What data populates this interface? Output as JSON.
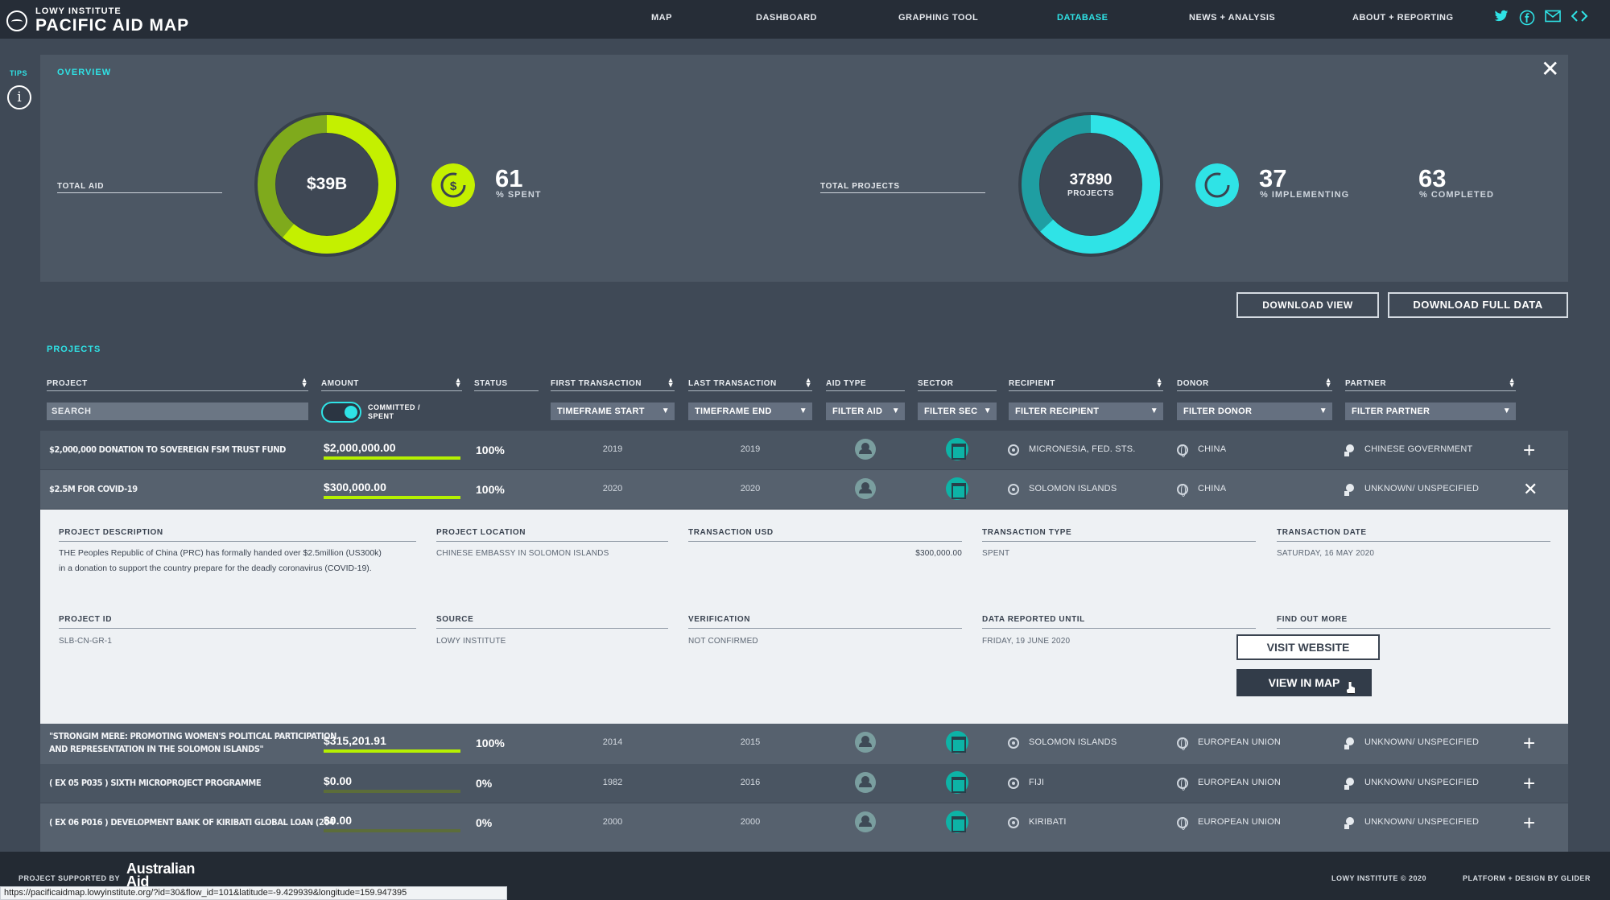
{
  "header": {
    "logo_small": "LOWY INSTITUTE",
    "logo_big": "PACIFIC AID MAP",
    "nav": [
      "MAP",
      "DASHBOARD",
      "GRAPHING TOOL",
      "DATABASE",
      "NEWS + ANALYSIS",
      "ABOUT + REPORTING"
    ],
    "active_nav": "DATABASE",
    "social_icons": [
      "twitter-icon",
      "facebook-icon",
      "mail-icon",
      "embed-icon"
    ]
  },
  "sidebar": {
    "tips_label": "TIPS"
  },
  "overview": {
    "title": "OVERVIEW",
    "total_aid_label": "TOTAL AID",
    "total_aid_value": "$39B",
    "spent_value": "61",
    "spent_label": "% SPENT",
    "spent_fraction": 0.61,
    "total_projects_label": "TOTAL PROJECTS",
    "projects_value": "37890",
    "projects_label": "PROJECTS",
    "implementing_value": "37",
    "implementing_label": "% IMPLEMENTING",
    "completed_value": "63",
    "completed_label": "% COMPLETED",
    "completed_fraction": 0.63,
    "accent_aid": "#c4f000",
    "accent_projects": "#2fe3e6"
  },
  "actions": {
    "download_view": "DOWNLOAD VIEW",
    "download_full": "DOWNLOAD FULL DATA"
  },
  "projects": {
    "title": "PROJECTS",
    "columns": [
      "PROJECT",
      "AMOUNT",
      "STATUS",
      "FIRST TRANSACTION",
      "LAST TRANSACTION",
      "AID TYPE",
      "SECTOR",
      "RECIPIENT",
      "DONOR",
      "PARTNER"
    ],
    "search_placeholder": "SEARCH",
    "toggle_label_1": "COMMITTED /",
    "toggle_label_2": "SPENT",
    "filters": {
      "timeframe_start": "TIMEFRAME START",
      "timeframe_end": "TIMEFRAME END",
      "aid": "FILTER AID",
      "sector": "FILTER SEC",
      "recipient": "FILTER RECIPIENT",
      "donor": "FILTER DONOR",
      "partner": "FILTER PARTNER"
    },
    "rows": [
      {
        "name": "$2,000,000 DONATION TO SOVEREIGN FSM TRUST FUND",
        "name2": "",
        "amount": "$2,000,000.00",
        "bar": 1.0,
        "status": "100%",
        "first": "2019",
        "last": "2019",
        "recipient": "MICRONESIA, FED. STS.",
        "donor": "CHINA",
        "partner": "CHINESE GOVERNMENT",
        "action": "+"
      },
      {
        "name": "$2.5M FOR COVID-19",
        "name2": "",
        "amount": "$300,000.00",
        "bar": 1.0,
        "status": "100%",
        "first": "2020",
        "last": "2020",
        "recipient": "SOLOMON ISLANDS",
        "donor": "CHINA",
        "partner": "UNKNOWN/ UNSPECIFIED",
        "action": "✕"
      },
      {
        "name": "\"STRONGIM MERE: PROMOTING WOMEN'S POLITICAL PARTICIPATION",
        "name2": "AND REPRESENTATION IN THE SOLOMON ISLANDS\"",
        "amount": "$315,201.91",
        "bar": 1.0,
        "status": "100%",
        "first": "2014",
        "last": "2015",
        "recipient": "SOLOMON ISLANDS",
        "donor": "EUROPEAN UNION",
        "partner": "UNKNOWN/ UNSPECIFIED",
        "action": "+"
      },
      {
        "name": "( EX 05 P035 ) SIXTH MICROPROJECT PROGRAMME",
        "name2": "",
        "amount": "$0.00",
        "bar": 0.0,
        "status": "0%",
        "first": "1982",
        "last": "2016",
        "recipient": "FIJI",
        "donor": "EUROPEAN UNION",
        "partner": "UNKNOWN/ UNSPECIFIED",
        "action": "+"
      },
      {
        "name": "( EX 06 P016 ) DEVELOPMENT BANK OF KIRIBATI GLOBAL LOAN (204",
        "name2": "",
        "amount": "$0.00",
        "bar": 0.0,
        "status": "0%",
        "first": "2000",
        "last": "2000",
        "recipient": "KIRIBATI",
        "donor": "EUROPEAN UNION",
        "partner": "UNKNOWN/ UNSPECIFIED",
        "action": "+"
      }
    ]
  },
  "detail": {
    "description_h": "PROJECT DESCRIPTION",
    "description_1": "THE Peoples Republic of China (PRC) has formally handed over $2.5million (US300k)",
    "description_2": "in a donation to support the country prepare for the deadly coronavirus (COVID-19).",
    "location_h": "PROJECT LOCATION",
    "location": "CHINESE EMBASSY IN SOLOMON ISLANDS",
    "tx_usd_h": "TRANSACTION USD",
    "tx_usd": "$300,000.00",
    "tx_type_h": "TRANSACTION TYPE",
    "tx_type": "SPENT",
    "tx_date_h": "TRANSACTION DATE",
    "tx_date": "SATURDAY, 16 MAY 2020",
    "project_id_h": "PROJECT ID",
    "project_id": "SLB-CN-GR-1",
    "source_h": "SOURCE",
    "source": "LOWY INSTITUTE",
    "verification_h": "VERIFICATION",
    "verification": "NOT CONFIRMED",
    "reported_h": "DATA REPORTED UNTIL",
    "reported": "FRIDAY, 19 JUNE 2020",
    "find_more_h": "FIND OUT MORE",
    "visit_btn": "VISIT WEBSITE",
    "map_btn": "VIEW IN MAP"
  },
  "footer": {
    "supported": "PROJECT SUPPORTED BY",
    "aus_1": "Australian",
    "aus_2": "Aid",
    "copyright": "LOWY INSTITUTE © 2020",
    "credit": "PLATFORM + DESIGN BY GLIDER"
  },
  "status_url": "https://pacificaidmap.lowyinstitute.org/?id=30&flow_id=101&latitude=-9.429939&longitude=159.947395"
}
